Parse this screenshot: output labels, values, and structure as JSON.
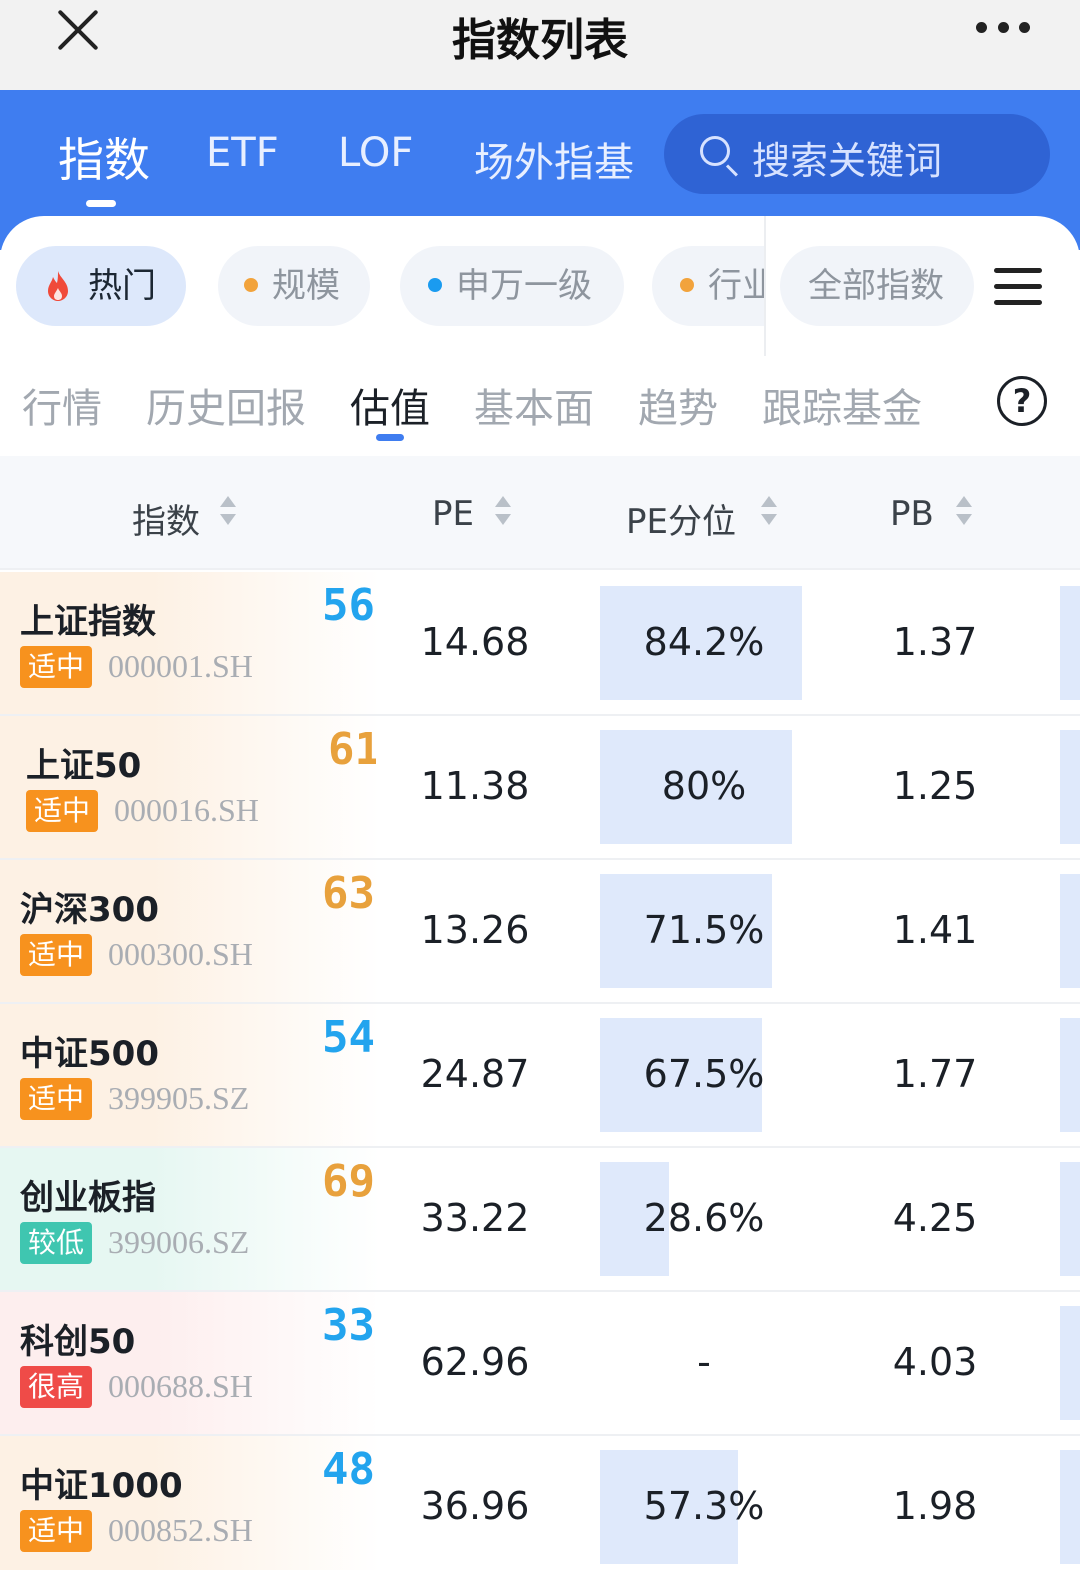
{
  "window": {
    "title": "指数列表"
  },
  "top_tabs": [
    {
      "label": "指数"
    },
    {
      "label": "ETF"
    },
    {
      "label": "LOF"
    },
    {
      "label": "场外指基"
    }
  ],
  "search": {
    "placeholder": "搜索关键词"
  },
  "categories": [
    {
      "label": "热门",
      "icon": "flame-icon",
      "color": "#f04a3a"
    },
    {
      "label": "规模",
      "dot_color": "#f2a33c"
    },
    {
      "label": "申万一级",
      "dot_color": "#1a9bf0"
    },
    {
      "label": "行业",
      "dot_color": "#f2a33c"
    },
    {
      "label": "全部指数"
    }
  ],
  "sub_tabs": [
    {
      "label": "行情"
    },
    {
      "label": "历史回报"
    },
    {
      "label": "估值"
    },
    {
      "label": "基本面"
    },
    {
      "label": "趋势"
    },
    {
      "label": "跟踪基金"
    }
  ],
  "table": {
    "headers": [
      "指数",
      "PE",
      "PE分位",
      "PB"
    ],
    "rows": [
      {
        "name": "上证指数",
        "badge": "适中",
        "badge_color": "#f7921e",
        "code": "000001.SH",
        "score": "56",
        "score_color": "#23a4ee",
        "pe": "14.68",
        "pe_pct": "84.2%",
        "pe_pct_value": 0.842,
        "pb": "1.37",
        "tint": "#fdf1e4"
      },
      {
        "name": "上证50",
        "badge": "适中",
        "badge_color": "#f7921e",
        "code": "000016.SH",
        "score": "61",
        "score_color": "#e8a13c",
        "pe": "11.38",
        "pe_pct": "80%",
        "pe_pct_value": 0.8,
        "pb": "1.25",
        "tint": "#fdf1e4"
      },
      {
        "name": "沪深300",
        "badge": "适中",
        "badge_color": "#f7921e",
        "code": "000300.SH",
        "score": "63",
        "score_color": "#e8a13c",
        "pe": "13.26",
        "pe_pct": "71.5%",
        "pe_pct_value": 0.715,
        "pb": "1.41",
        "tint": "#fdf1e4"
      },
      {
        "name": "中证500",
        "badge": "适中",
        "badge_color": "#f7921e",
        "code": "399905.SZ",
        "score": "54",
        "score_color": "#23a4ee",
        "pe": "24.87",
        "pe_pct": "67.5%",
        "pe_pct_value": 0.675,
        "pb": "1.77",
        "tint": "#fdf1e4"
      },
      {
        "name": "创业板指",
        "badge": "较低",
        "badge_color": "#3fc6b0",
        "code": "399006.SZ",
        "score": "69",
        "score_color": "#e8a13c",
        "pe": "33.22",
        "pe_pct": "28.6%",
        "pe_pct_value": 0.286,
        "pb": "4.25",
        "tint": "#e6f7f2"
      },
      {
        "name": "科创50",
        "badge": "很高",
        "badge_color": "#ef4b48",
        "code": "000688.SH",
        "score": "33",
        "score_color": "#23a4ee",
        "pe": "62.96",
        "pe_pct": "-",
        "pe_pct_value": 0,
        "pb": "4.03",
        "tint": "#fdeeee"
      },
      {
        "name": "中证1000",
        "badge": "适中",
        "badge_color": "#f7921e",
        "code": "000852.SH",
        "score": "48",
        "score_color": "#23a4ee",
        "pe": "36.96",
        "pe_pct": "57.3%",
        "pe_pct_value": 0.573,
        "pb": "1.98",
        "tint": "#fdf1e4"
      }
    ]
  }
}
